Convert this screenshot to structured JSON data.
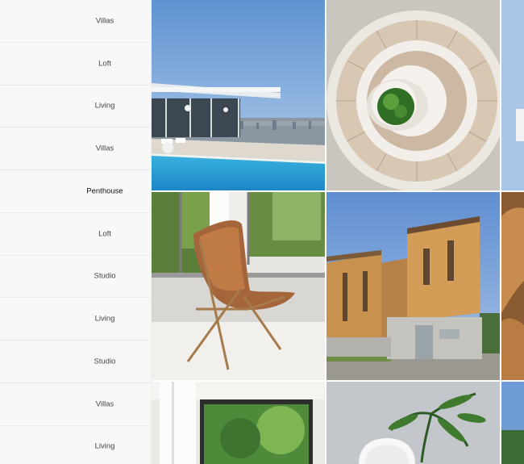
{
  "categories": [
    {
      "label": "Villas"
    },
    {
      "label": "Loft"
    },
    {
      "label": "Living"
    },
    {
      "label": "Villas"
    },
    {
      "label": "Penthouse",
      "cut_text": "e"
    },
    {
      "label": "Loft"
    },
    {
      "label": "Studio"
    },
    {
      "label": "Living"
    },
    {
      "label": "Studio"
    },
    {
      "label": "Villas"
    },
    {
      "label": "Living"
    }
  ],
  "colors": {
    "list_background": "#f8f8f8",
    "divider": "#e9e9e9",
    "label_text": "#444444"
  },
  "photos": [
    {
      "subject": "modern villa with pool overlooking city"
    },
    {
      "subject": "spiral staircase from above"
    },
    {
      "subject": "butterfly leather chair by window"
    },
    {
      "subject": "wooden modern house exterior"
    },
    {
      "subject": "large window with garden view"
    },
    {
      "subject": "palm plant and white chair"
    }
  ]
}
